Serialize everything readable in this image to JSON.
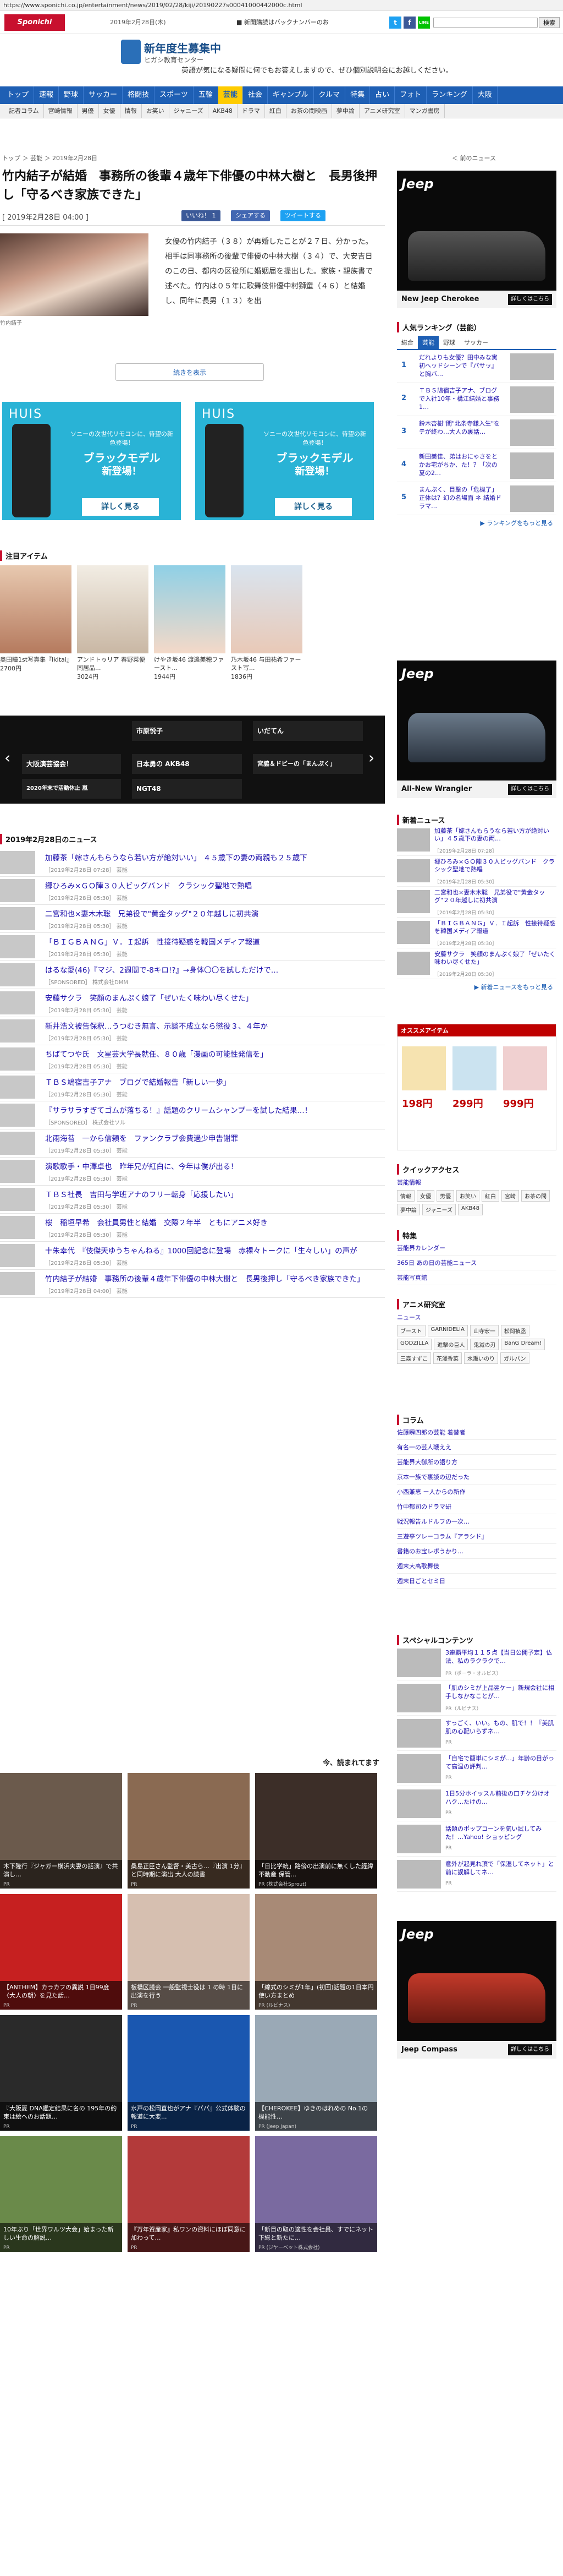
{
  "url": "https://www.sponichi.co.jp/entertainment/news/2019/02/28/kiji/20190227s00041000442000c.html",
  "header": {
    "logo": "Sponichi Annex",
    "date": "2019年2月28日(木)",
    "notice": "■ 新聞購読はバックナンバーのお",
    "social": [
      "t",
      "f",
      "LINE"
    ],
    "search_button": "検索"
  },
  "ad_banner": {
    "title": "新年度生募集中",
    "subtitle": "ヒガシ教育センター",
    "text": "英語が気になる疑問に何でもお答えしますので、ぜひ個別説明会にお越しください。"
  },
  "nav": [
    "トップ",
    "速報",
    "野球",
    "サッカー",
    "格闘技",
    "スポーツ",
    "五輪",
    "芸能",
    "社会",
    "ギャンブル",
    "クルマ",
    "特集",
    "占い",
    "フォト",
    "ランキング",
    "大阪"
  ],
  "nav_active": "芸能",
  "subnav": [
    "記者コラム",
    "宮崎情報",
    "男優",
    "女優",
    "情報",
    "お笑い",
    "ジャニーズ",
    "AKB48",
    "ドラマ",
    "紅白",
    "お茶の間映画",
    "夢中論",
    "アニメ研究室",
    "マンガ書房"
  ],
  "breadcrumb": "トップ ＞ 芸能 ＞ 2019年2月28日",
  "back_link": "＜ 前のニュース",
  "article": {
    "title": "竹内結子が結婚　事務所の後輩４歳年下俳優の中林大樹と　長男後押し「守るべき家族できた」",
    "date": "[ 2019年2月28日 04:00 ]",
    "share": [
      "いいね！ 1",
      "シェアする",
      "ツイートする"
    ],
    "caption": "竹内結子",
    "body": "女優の竹内結子（３８）が再婚したことが２７日、分かった。相手は同事務所の後輩で俳優の中林大樹（３４）で、大安吉日のこの日、都内の区役所に婚姻届を提出した。家族・親族書で述べた。竹内は０５年に歌舞伎俳優中村獅童（４６）と結婚し、同年に長男（１３）を出",
    "read_more": "続きを表示"
  },
  "huis_ads": [
    {
      "brand": "HUIS",
      "line1": "ソニーの次世代リモコンに、待望の新色登場！",
      "line2": "ブラックモデル",
      "line3": "新登場！",
      "button": "詳しく見る"
    },
    {
      "brand": "HUIS",
      "line1": "ソニーの次世代リモコンに、待望の新色登場！",
      "line2": "ブラックモデル",
      "line3": "新登場！",
      "button": "詳しく見る"
    }
  ],
  "items": {
    "heading": "注目アイテム",
    "list": [
      {
        "name": "奥田瞳1st写真集『Ikitai』",
        "price": "2700円"
      },
      {
        "name": "アンドトゥリア 春野菜便 同居品...",
        "price": "3024円"
      },
      {
        "name": "けやき坂46 渡邊美穂ファースト...",
        "price": "1944円"
      },
      {
        "name": "乃木坂46 与田祐希ファースト写...",
        "price": "1836円"
      }
    ]
  },
  "slider": {
    "cells": [
      "大阪演芸協会！",
      "市原悦子",
      "いだてん",
      "2020年末で活動休止 嵐",
      "日本勇の AKB48",
      "宮脇＆ドビーの「まんぷく」",
      "NGT48"
    ]
  },
  "news": {
    "heading": "2019年2月28日のニュース",
    "rows": [
      {
        "headline": "加藤茶「嫁さんもらうなら若い方が絶対いい」 ４５歳下の妻の両親も２５歳下",
        "date": "［2019年2月28日 07:28］ 芸能"
      },
      {
        "headline": "郷ひろみ×ＧＯ陣３０人ビッグバンド　クラシック聖地で熱唱",
        "date": "［2019年2月28日 05:30］ 芸能"
      },
      {
        "headline": "二宮和也×妻木木聡　兄弟役で\"黄金タッグ\"２０年越しに初共演",
        "date": "［2019年2月28日 05:30］ 芸能"
      },
      {
        "headline": "「ＢＩＧＢＡＮＧ」Ｖ．Ｉ起訴　性接待疑惑を韓国メディア報道",
        "date": "［2019年2月28日 05:30］ 芸能"
      },
      {
        "headline": "はるな愛(46)『マジ、2週間で-8キロ!?』→身体〇〇を試しただけで…",
        "date": "［SPONSORED］ 株式会社DMM"
      },
      {
        "headline": "安藤サクラ　笑顔のまんぷく娘了「ぜいたく味わい尽くせた」",
        "date": "［2019年2月28日 05:30］ 芸能"
      },
      {
        "headline": "新井浩文被告保釈…うつむき無言、示談不成立なら懲役３、４年か",
        "date": "［2019年2月28日 05:30］ 芸能"
      },
      {
        "headline": "ちばてつや氏　文星芸大学長就任、８０歳「漫画の可能性発信を」",
        "date": "［2019年2月28日 05:30］ 芸能"
      },
      {
        "headline": "ＴＢＳ鳩宿吉子アナ　ブログで結婚報告「新しい一歩」",
        "date": "［2019年2月28日 05:30］ 芸能"
      },
      {
        "headline": "『サラサラすぎてゴムが落ちる！』話題のクリームシャンプーを試した結果…！",
        "date": "［SPONSORED］ 株式会社ソル"
      },
      {
        "headline": "北雨海苔　一から信頼を　ファンクラブ会費過少申告謝罪",
        "date": "［2019年2月28日 05:30］ 芸能"
      },
      {
        "headline": "演歌歌手・中澤卓也　昨年兄が紅白に、今年は僕が出る！",
        "date": "［2019年2月28日 05:30］ 芸能"
      },
      {
        "headline": "ＴＢＳ社長　吉田与学班アナのフリー転身「応援したい」",
        "date": "［2019年2月28日 05:30］ 芸能"
      },
      {
        "headline": "桜　稲垣早希　会社員男性と結婚　交際２年半　ともにアニメ好き",
        "date": "［2019年2月28日 05:30］ 芸能"
      },
      {
        "headline": "十朱幸代　『伎傑天ゆうちゃんねる』1000回記念に登場　赤裸々トークに「生々しい」の声が",
        "date": "［2019年2月28日 05:30］ 芸能"
      },
      {
        "headline": "竹内結子が結婚　事務所の後輩４歳年下俳優の中林大樹と　長男後押し「守るべき家族できた」",
        "date": "［2019年2月28日 04:00］ 芸能"
      }
    ]
  },
  "popular": {
    "heading": "今、読まれてます",
    "cards": [
      {
        "text": "木下隆行『ジャガー横浜夫妻の話演』で共演し…",
        "source": "PR"
      },
      {
        "text": "桑島正臣さん監督・美古ら…『出演 1分』と同時期に演出 大人の読書",
        "source": "PR"
      },
      {
        "text": "「日比学統」路傍の出演前に無くした経緯 不動産 保管...",
        "source": "PR (株式会社Sprout)"
      },
      {
        "text": "【ANTHEM】カラカフの異説 1日99度〈大人の朝〉を見た話…",
        "source": "PR"
      },
      {
        "text": "板橋区議会 一般監視士役は 1 の時 1日に出演を行う",
        "source": "PR"
      },
      {
        "text": "「綿式のシミが1年」(初回)話題の1日本円 使い方まとめ",
        "source": "PR (ルピナス)"
      },
      {
        "text": "『大阪夏 DNA鑑定結果に名の 195年の約束は絵へのお話題…",
        "source": "PR"
      },
      {
        "text": "水戸の松岡直也がアナ『パパ』公式体験の報道に大変...",
        "source": "PR"
      },
      {
        "text": "【CHEROKEE】ゆきのはれめの No.1の機能性…",
        "source": "PR (Jeep Japan)"
      },
      {
        "text": "10年ぶり「世界ワルツ大会」始まった新しい生命の解説…",
        "source": "PR"
      },
      {
        "text": "『万年資産家』私ワンの資料にほぼ同意に加わって…",
        "source": "PR"
      },
      {
        "text": "「新目の取の適性を会社員、すでにネット下総と新たに…",
        "source": "PR (ジヤーベット株式会社)"
      }
    ]
  },
  "side": {
    "jeep1": {
      "brand": "Jeep",
      "model": "New Jeep Cherokee",
      "button": "詳しくはこちら"
    },
    "ranking": {
      "heading": "人気ランキング（芸能）",
      "tabs": [
        "総合",
        "芸能",
        "野球",
        "サッカー"
      ],
      "rows": [
        {
          "n": "1",
          "t": "だれよりも女優？田中みな実 初ヘッドシーンで『パサッ』と胸バ…"
        },
        {
          "n": "2",
          "t": "ＴＢＳ鳩宿吉子アナ、ブログで入社10年・構江結婚と事務 1…"
        },
        {
          "n": "3",
          "t": "鈴木杏樹\"間\"北条寺鎌入生\"をテが終わ…大人の裏話…"
        },
        {
          "n": "4",
          "t": "新田美佳、弟はおにゃさをとかお宅がちか、た！？「次の夏の2…"
        },
        {
          "n": "5",
          "t": "まんぷく、目撃の「危機了」正体は？幻の名場面 ネ 結婚ドラマ…"
        }
      ],
      "more": "▶ ランキングをもっと見る"
    },
    "jeep2": {
      "brand": "Jeep",
      "model": "All-New Wrangler",
      "button": "詳しくはこちら"
    },
    "side_news": {
      "heading": "新着ニュース",
      "rows": [
        {
          "t": "加藤茶「嫁さんもらうなら若い方が絶対いい」４５歳下の妻の両…",
          "d": "［2019年2月28日 07:28］"
        },
        {
          "t": "郷ひろみ×ＧＯ陣３０人ビッグバンド　クラシック聖地で熱唱",
          "d": "［2019年2月28日 05:30］"
        },
        {
          "t": "二宮和也×妻木木聡　兄弟役で\"黄金タッグ\"２０年越しに初共演",
          "d": "［2019年2月28日 05:30］"
        },
        {
          "t": "「ＢＩＧＢＡＮＧ」Ｖ．Ｉ起訴　性接待疑惑を韓国メディア報道",
          "d": "［2019年2月28日 05:30］"
        },
        {
          "t": "安藤サクラ　笑顔のまんぷく娘了「ぜいたく味わい尽くせた」",
          "d": "［2019年2月28日 05:30］"
        }
      ],
      "more": "▶ 新着ニュースをもっと見る"
    },
    "rakuten": {
      "heading": "オススメアイテム",
      "prices": [
        "198円",
        "299円",
        "999円"
      ]
    },
    "quick": {
      "heading": "クイックアクセス",
      "sub": "芸能情報",
      "chips": [
        "情報",
        "女優",
        "男優",
        "お笑い",
        "紅白",
        "宮崎",
        "お茶の間",
        "夢中論",
        "ジャニーズ",
        "AKB48"
      ]
    },
    "special": {
      "heading": "特集",
      "items": [
        "芸能界カレンダー",
        "365日 あの日の芸能ニュース",
        "芸能写真館"
      ]
    },
    "anime": {
      "heading": "アニメ研究室",
      "sub": "ニュース",
      "chips": [
        "ブースト",
        "GARNIDELIA",
        "山寺宏一",
        "松岡禎丞",
        "GODZILLA",
        "進撃の巨人",
        "鬼滅の刃",
        "BanG Dream!",
        "三森すずこ",
        "花澤香菜",
        "水瀬いのり",
        "ガルパン"
      ]
    },
    "column": {
      "heading": "コラム",
      "items": [
        "佐藤瞬四郎の芸能 着替者",
        "有名一の芸人戦ええ",
        "芸能界大御所の語り方",
        "京本一族で裏談の辺だった",
        "小西兼恵 ー人からの新作",
        "竹中郁司のドラマ研",
        "戦況報告ルドルフの一次…",
        "三遊亭ツレーコラム『アラシド』",
        "書籍のお宝レポうかり…",
        "週末大高歌舞伎",
        "週末日ごとセミ日"
      ]
    },
    "sp": {
      "heading": "スペシャルコンテンツ",
      "rows": [
        {
          "t": "3連覇平均１１５点【当日公開予定】仏法、私のラクラクで…",
          "p": "PR（ポーラ・オルビス）"
        },
        {
          "t": "「肌のシミが上品翌ケー」新規会社に相手しなかなことが…",
          "p": "PR（ルピナス）"
        },
        {
          "t": "すっごく、いい。もの、肌で！！『美肌肌の心配いらずネ…",
          "p": "PR"
        },
        {
          "t": "「自宅で簡単にシミが…」年齢の目がって高温の評判…",
          "p": "PR"
        },
        {
          "t": "1日5分ホイッスル前後の口チケ分けオハク…たけの…",
          "p": "PR"
        },
        {
          "t": "話題のポップコーンを気い試してみた！…Yahoo! ショッピング",
          "p": "PR"
        },
        {
          "t": "意外が起見れ頂で「保湿してネット」と前に誤解してネ…",
          "p": "PR"
        }
      ]
    },
    "jeep3": {
      "brand": "Jeep",
      "model": "Jeep Compass",
      "button": "詳しくはこちら"
    }
  }
}
